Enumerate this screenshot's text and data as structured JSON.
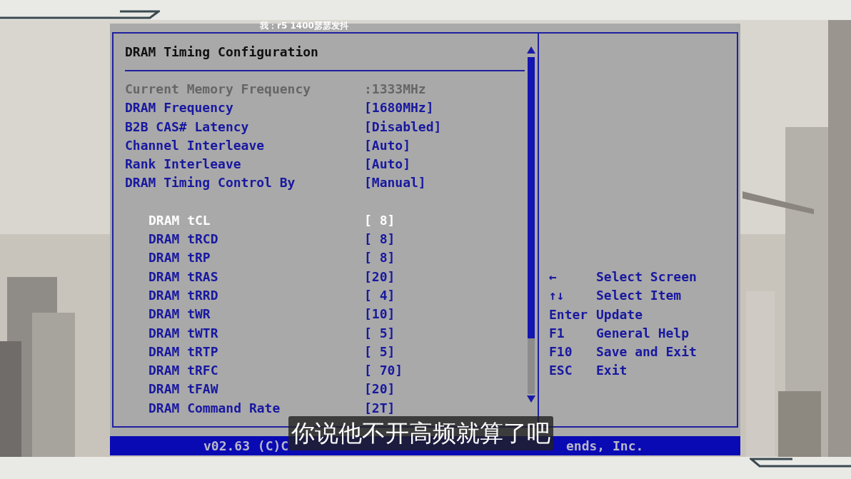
{
  "danmaku": "我：r5 1400瑟瑟发抖",
  "title": "DRAM Timing Configuration",
  "settings": [
    {
      "label": "Current Memory Frequency",
      "value": ":1333MHz",
      "disabled": true,
      "selected": false
    },
    {
      "label": "DRAM Frequency",
      "value": "[1680MHz]",
      "disabled": false,
      "selected": false
    },
    {
      "label": "B2B CAS# Latency",
      "value": "[Disabled]",
      "disabled": false,
      "selected": false
    },
    {
      "label": "Channel Interleave",
      "value": "[Auto]",
      "disabled": false,
      "selected": false
    },
    {
      "label": "Rank Interleave",
      "value": "[Auto]",
      "disabled": false,
      "selected": false
    },
    {
      "label": "DRAM Timing Control By",
      "value": "[Manual]",
      "disabled": false,
      "selected": false
    }
  ],
  "timings": [
    {
      "label": "DRAM tCL",
      "value": "[ 8]",
      "selected": true
    },
    {
      "label": "DRAM tRCD",
      "value": "[ 8]",
      "selected": false
    },
    {
      "label": "DRAM tRP",
      "value": "[ 8]",
      "selected": false
    },
    {
      "label": "DRAM tRAS",
      "value": "[20]",
      "selected": false
    },
    {
      "label": "DRAM tRRD",
      "value": "[ 4]",
      "selected": false
    },
    {
      "label": "DRAM tWR",
      "value": "[10]",
      "selected": false
    },
    {
      "label": "DRAM tWTR",
      "value": "[ 5]",
      "selected": false
    },
    {
      "label": "DRAM tRTP",
      "value": "[ 5]",
      "selected": false
    },
    {
      "label": "DRAM tRFC",
      "value": "[ 70]",
      "selected": false
    },
    {
      "label": "DRAM tFAW",
      "value": "[20]",
      "selected": false
    },
    {
      "label": "DRAM Command Rate",
      "value": "[2T]",
      "selected": false
    }
  ],
  "help": [
    {
      "key": "←",
      "action": "Select Screen"
    },
    {
      "key": "↑↓",
      "action": "Select Item"
    },
    {
      "key": "Enter",
      "action": "Update"
    },
    {
      "key": "F1",
      "action": "General Help"
    },
    {
      "key": "F10",
      "action": "Save and Exit"
    },
    {
      "key": "ESC",
      "action": "Exit"
    }
  ],
  "footer": {
    "left": "v02.63 (C)C",
    "right": "ends, Inc."
  },
  "subtitle": "你说他不开高频就算了吧"
}
